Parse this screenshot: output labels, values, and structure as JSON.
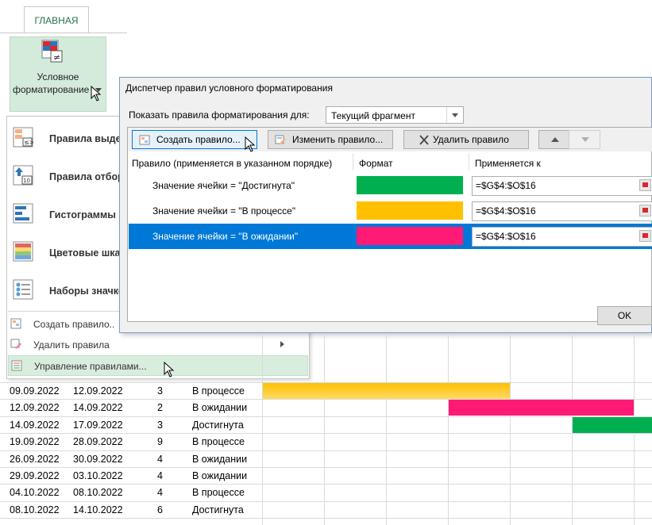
{
  "ribbon": {
    "tab_home": "ГЛАВНАЯ",
    "cf_button_line1": "Условное",
    "cf_button_line2": "форматирование"
  },
  "menu": {
    "big_items": [
      {
        "label": "Правила выделения ячеек",
        "icon": "highlight-rules-icon"
      },
      {
        "label": "Правила отбора первых и последних значений",
        "icon": "top-bottom-icon"
      },
      {
        "label": "Гистограммы",
        "icon": "data-bars-icon"
      },
      {
        "label": "Цветовые шкалы",
        "icon": "color-scales-icon"
      },
      {
        "label": "Наборы значков",
        "icon": "icon-sets-icon"
      }
    ],
    "big_items_visible": [
      "Правила выде",
      "Правила отбор",
      "Гистограммы",
      "Цветовые шка",
      "Наборы значко"
    ],
    "small_items": [
      {
        "label": "Создать правило...",
        "visible": "Создать правило..",
        "icon": "new-rule-icon"
      },
      {
        "label": "Удалить правила",
        "visible": "Удалить правила",
        "icon": "clear-rules-icon"
      },
      {
        "label": "Управление правилами...",
        "visible": "Управление правилами...",
        "icon": "manage-rules-icon"
      }
    ]
  },
  "dialog": {
    "title": "Диспетчер правил условного форматирования",
    "show_rules_label": "Показать правила форматирования для:",
    "scope_value": "Текущий фрагмент",
    "buttons": {
      "new_rule": "Создать правило...",
      "edit_rule": "Изменить правило...",
      "delete_rule": "Удалить правило"
    },
    "columns": {
      "rule": "Правило (применяется в указанном порядке)",
      "format": "Формат",
      "applies_to": "Применяется к"
    },
    "rules": [
      {
        "rule": "Значение ячейки = \"Достигнута\"",
        "format_color": "#00b050",
        "applies_to": "=$G$4:$O$16"
      },
      {
        "rule": "Значение ячейки = \"В процессе\"",
        "format_color": "#ffc000",
        "applies_to": "=$G$4:$O$16"
      },
      {
        "rule": "Значение ячейки = \"В ожидании\"",
        "format_color": "#ff1a75",
        "applies_to": "=$G$4:$O$16"
      }
    ],
    "ok": "OK"
  },
  "colors": {
    "done": "#00b050",
    "in_progress": "#ffc000",
    "waiting": "#ff1a75",
    "selection": "#0078d7",
    "excel_green": "#217346"
  },
  "sheet": {
    "rows": [
      {
        "start": "09.09.2022",
        "end": "12.09.2022",
        "days": "3",
        "status": "В процессе"
      },
      {
        "start": "12.09.2022",
        "end": "14.09.2022",
        "days": "2",
        "status": "В ожидании"
      },
      {
        "start": "14.09.2022",
        "end": "17.09.2022",
        "days": "3",
        "status": "Достигнута"
      },
      {
        "start": "19.09.2022",
        "end": "28.09.2022",
        "days": "9",
        "status": "В процессе"
      },
      {
        "start": "26.09.2022",
        "end": "30.09.2022",
        "days": "4",
        "status": "В ожидании"
      },
      {
        "start": "29.09.2022",
        "end": "03.10.2022",
        "days": "4",
        "status": "В ожидании"
      },
      {
        "start": "04.10.2022",
        "end": "08.10.2022",
        "days": "4",
        "status": "В процессе"
      },
      {
        "start": "08.10.2022",
        "end": "14.10.2022",
        "days": "6",
        "status": "Достигнута"
      }
    ]
  }
}
